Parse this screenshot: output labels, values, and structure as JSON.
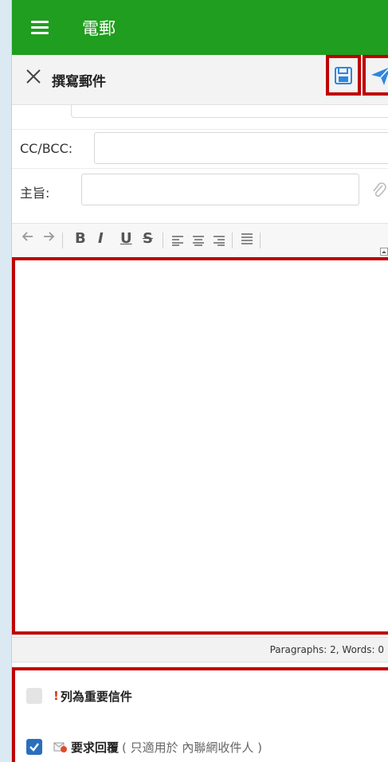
{
  "app": {
    "title": "電郵"
  },
  "compose": {
    "title": "撰寫郵件"
  },
  "fields": {
    "cc_label": "CC/BCC:",
    "subject_label": "主旨:"
  },
  "toolbar": {
    "bold": "B",
    "italic": "I",
    "underline": "U",
    "strike": "S"
  },
  "status": {
    "text": "Paragraphs: 2, Words: 0"
  },
  "options": {
    "important": {
      "icon_text": "!",
      "label": "列為重要信件",
      "checked": false
    },
    "read_receipt": {
      "label": "要求回覆",
      "note": "( 只適用於 內聯網收件人 )",
      "checked": true
    }
  },
  "colors": {
    "appbar": "#1f9e1f",
    "highlight": "#c00000",
    "checkbox_on": "#2a6fbd",
    "send": "#2e86de"
  }
}
